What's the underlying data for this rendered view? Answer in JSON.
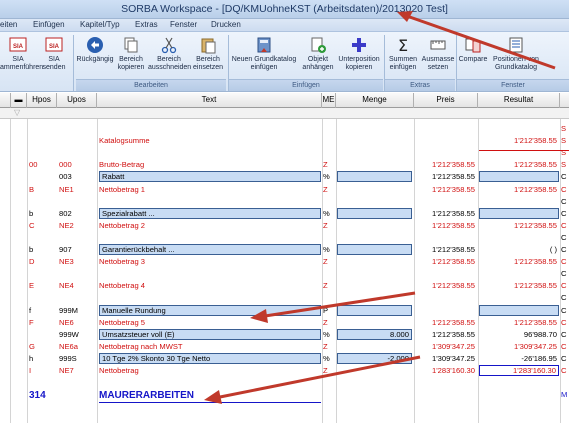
{
  "window": {
    "title": "SORBA Workspace - [DQ/KMUohneKST (Arbeitsdaten)/2013020 Test]"
  },
  "menu": [
    "eiten",
    "Einfügen",
    "Kapitel/Typ",
    "Extras",
    "Fenster",
    "Drucken"
  ],
  "ribbon": {
    "buttons": [
      {
        "label": "SIA\nammenführen",
        "icon": "sia-merge-icon"
      },
      {
        "label": "SIA\nsenden",
        "icon": "sia-send-icon"
      },
      {
        "label": "Rückgängig",
        "icon": "undo-icon"
      },
      {
        "label": "Bereich\nkopieren",
        "icon": "copy-icon"
      },
      {
        "label": "Bereich\nausschneiden",
        "icon": "scissors-icon"
      },
      {
        "label": "Bereich\neinsetzen",
        "icon": "paste-icon"
      },
      {
        "label": "Neuen Grundkatalog\neinfügen",
        "icon": "catalog-icon"
      },
      {
        "label": "Objekt\nanhängen",
        "icon": "object-add-icon"
      },
      {
        "label": "Unterposition\nkopieren",
        "icon": "plus-icon"
      },
      {
        "label": "Summen\neinfügen",
        "icon": "sigma-icon"
      },
      {
        "label": "Ausmasse\nsetzen",
        "icon": "measure-icon"
      },
      {
        "label": "Compare",
        "icon": "compare-icon"
      },
      {
        "label": "Positionen von\nGrundkatalog",
        "icon": "positions-icon"
      }
    ],
    "groups": [
      "Bearbeiten",
      "Einfügen",
      "Extras",
      "Fenster"
    ]
  },
  "grid": {
    "columns": [
      "Hpos",
      "Upos",
      "Text",
      "ME",
      "Menge",
      "Preis",
      "Resultat"
    ],
    "rows": [
      {
        "hpos": "",
        "upos": "",
        "text": "",
        "me": "",
        "menge": "",
        "preis": "",
        "resultat": "",
        "ext": "S",
        "style": "plain"
      },
      {
        "hpos": "",
        "upos": "",
        "text": "Katalogsumme",
        "me": "",
        "menge": "",
        "preis": "",
        "resultat": "1'212'358.55",
        "ext": "S",
        "style": "red"
      },
      {
        "hpos": "",
        "upos": "",
        "text": "",
        "me": "",
        "menge": "",
        "preis": "",
        "resultat": "",
        "ext": "S",
        "style": "plain"
      },
      {
        "hpos": "00",
        "upos": "000",
        "text": "Brutto-Betrag",
        "me": "Z",
        "menge": "",
        "preis": "1'212'358.55",
        "resultat": "1'212'358.55",
        "ext": "S",
        "style": "red"
      },
      {
        "hpos": "",
        "upos": "003",
        "text": "Rabatt",
        "me": "%",
        "menge": "",
        "preis": "1'212'358.55",
        "resultat": "",
        "ext": "C",
        "style": "boxed"
      },
      {
        "hpos": "B",
        "upos": "NE1",
        "text": "Nettobetrag 1",
        "me": "Z",
        "menge": "",
        "preis": "1'212'358.55",
        "resultat": "1'212'358.55",
        "ext": "C",
        "style": "red"
      },
      {
        "hpos": "",
        "upos": "",
        "text": "",
        "me": "",
        "menge": "",
        "preis": "",
        "resultat": "",
        "ext": "C",
        "style": "plain"
      },
      {
        "hpos": "b",
        "upos": "802",
        "text": "Spezialrabatt ...",
        "me": "%",
        "menge": "",
        "preis": "1'212'358.55",
        "resultat": "",
        "ext": "C",
        "style": "boxed"
      },
      {
        "hpos": "C",
        "upos": "NE2",
        "text": "Nettobetrag 2",
        "me": "Z",
        "menge": "",
        "preis": "1'212'358.55",
        "resultat": "1'212'358.55",
        "ext": "C",
        "style": "red"
      },
      {
        "hpos": "",
        "upos": "",
        "text": "",
        "me": "",
        "menge": "",
        "preis": "",
        "resultat": "",
        "ext": "C",
        "style": "plain"
      },
      {
        "hpos": "b",
        "upos": "907",
        "text": "Garantierückbehalt ...",
        "me": "%",
        "menge": "",
        "preis": "1'212'358.55",
        "resultat": "(          )",
        "ext": "C",
        "style": "boxed"
      },
      {
        "hpos": "D",
        "upos": "NE3",
        "text": "Nettobetrag 3",
        "me": "Z",
        "menge": "",
        "preis": "1'212'358.55",
        "resultat": "1'212'358.55",
        "ext": "C",
        "style": "red"
      },
      {
        "hpos": "",
        "upos": "",
        "text": "",
        "me": "",
        "menge": "",
        "preis": "",
        "resultat": "",
        "ext": "C",
        "style": "plain"
      },
      {
        "hpos": "E",
        "upos": "NE4",
        "text": "Nettobetrag 4",
        "me": "Z",
        "menge": "",
        "preis": "1'212'358.55",
        "resultat": "1'212'358.55",
        "ext": "C",
        "style": "red"
      },
      {
        "hpos": "",
        "upos": "",
        "text": "",
        "me": "",
        "menge": "",
        "preis": "",
        "resultat": "",
        "ext": "C",
        "style": "plain"
      },
      {
        "hpos": "f",
        "upos": "999M",
        "text": "Manuelle Rundung",
        "me": "P",
        "menge": "",
        "preis": "",
        "resultat": "",
        "ext": "C",
        "style": "boxed"
      },
      {
        "hpos": "F",
        "upos": "NE6",
        "text": "Nettobetrag 5",
        "me": "Z",
        "menge": "",
        "preis": "1'212'358.55",
        "resultat": "1'212'358.55",
        "ext": "C",
        "style": "red"
      },
      {
        "hpos": "",
        "upos": "999W",
        "text": "Umsatzsteuer voll (E)",
        "me": "%",
        "menge": "8.000",
        "preis": "1'212'358.55",
        "resultat": "96'988.70",
        "ext": "C",
        "style": "boxed"
      },
      {
        "hpos": "G",
        "upos": "NE6a",
        "text": "Nettobetrag nach MWST",
        "me": "Z",
        "menge": "",
        "preis": "1'309'347.25",
        "resultat": "1'309'347.25",
        "ext": "C",
        "style": "red"
      },
      {
        "hpos": "h",
        "upos": "999S",
        "text": "10 Tge 2% Skonto 30 Tge Netto",
        "me": "%",
        "menge": "-2.000",
        "preis": "1'309'347.25",
        "resultat": "-26'186.95",
        "ext": "C",
        "style": "boxed"
      },
      {
        "hpos": "I",
        "upos": "NE7",
        "text": "Nettobetrag",
        "me": "Z",
        "menge": "",
        "preis": "1'283'160.30",
        "resultat": "1'283'160.30",
        "ext": "C",
        "style": "red"
      },
      {
        "hpos": "",
        "upos": "",
        "text": "",
        "me": "",
        "menge": "",
        "preis": "",
        "resultat": "",
        "ext": "",
        "style": "plain"
      },
      {
        "hpos": "314",
        "upos": "",
        "text": "MAURERARBEITEN",
        "me": "",
        "menge": "",
        "preis": "",
        "resultat": "",
        "ext": "M",
        "style": "sum"
      }
    ]
  },
  "colors": {
    "red": "#d01010",
    "blue": "#1515c8",
    "arrow": "#c0392b",
    "box_fill": "#c8dcf4"
  }
}
